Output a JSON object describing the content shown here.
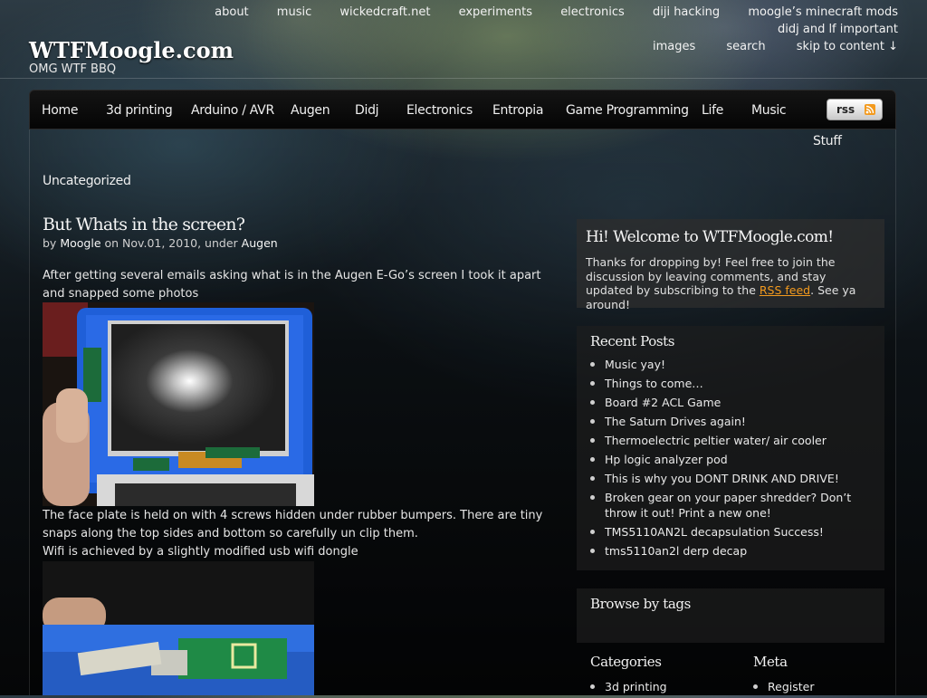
{
  "top_nav": {
    "row1": [
      "about",
      "music",
      "wickedcraft.net",
      "experiments",
      "electronics",
      "diji hacking",
      "moogle’s minecraft mods",
      "didj and lf important"
    ],
    "row2": [
      "images",
      "search",
      "skip to content ↓"
    ]
  },
  "site": {
    "title": "WTFMoogle.com",
    "tagline": "OMG WTF BBQ"
  },
  "main_nav": {
    "items": [
      "Home",
      "3d printing",
      "Arduino / AVR",
      "Augen",
      "Didj",
      "Electronics",
      "Entropia",
      "Game Programming",
      "Life",
      "Music",
      "Stuff",
      "Uncategorized"
    ],
    "rss_label": "rss"
  },
  "post": {
    "title": "But Whats in the screen?",
    "meta": {
      "by": "by",
      "author": "Moogle",
      "on": "on Nov.01, 2010, under",
      "category": "Augen"
    },
    "paragraph1": "After getting several emails asking what is in the Augen E-Go’s screen I took it apart and snapped some photos",
    "paragraph2": "The face plate is held on with 4 screws hidden under rubber bumpers. There are tiny snaps along the top sides and bottom so carefully un clip them.",
    "paragraph3": "Wifi is achieved by a slightly modified usb wifi dongle"
  },
  "sidebar": {
    "welcome": {
      "title": "Hi! Welcome to WTFMoogle.com!",
      "text_before": "Thanks for dropping by! Feel free to join the discussion by leaving comments, and stay updated by subscribing to the ",
      "link": "RSS feed",
      "text_after": ". See ya around!"
    },
    "recent_posts": {
      "title": "Recent Posts",
      "items": [
        "Music yay!",
        "Things to come…",
        "Board #2 ACL Game",
        "The Saturn Drives again!",
        "Thermoelectric peltier water/ air cooler",
        "Hp logic analyzer pod",
        "This is why you DONT DRINK AND DRIVE!",
        "Broken gear on your paper shredder? Don’t throw it out! Print a new one!",
        "TMS5110AN2L decapsulation Success!",
        "tms5110an2l derp decap"
      ]
    },
    "tags": {
      "title": "Browse by tags"
    },
    "categories": {
      "title": "Categories",
      "items": [
        "3d printing"
      ]
    },
    "meta": {
      "title": "Meta",
      "items": [
        "Register"
      ]
    }
  },
  "colors": {
    "accent_link": "#f39a1e",
    "nav_bg": "#0a0a0a"
  }
}
